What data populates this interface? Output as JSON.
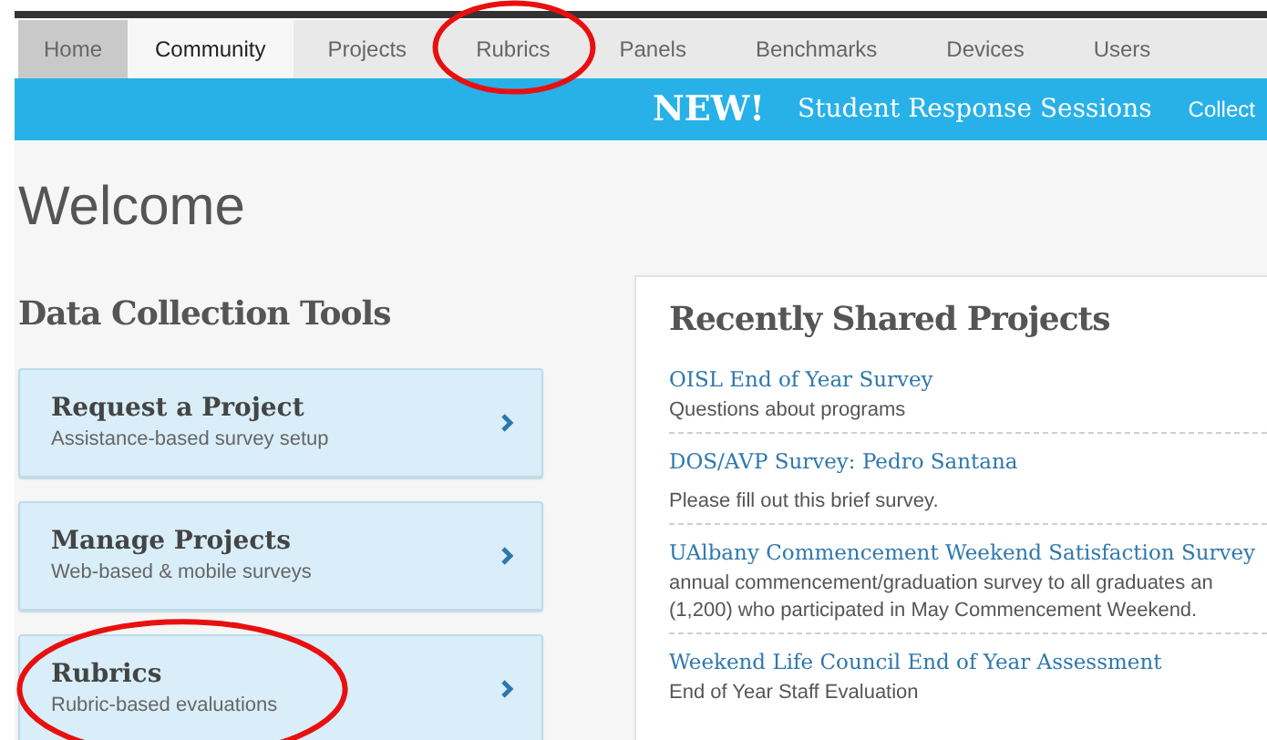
{
  "nav": {
    "items": [
      {
        "label": "Home",
        "selected": false,
        "highlighted": true
      },
      {
        "label": "Community",
        "selected": true,
        "highlighted": false
      },
      {
        "label": "Projects",
        "selected": false,
        "highlighted": false
      },
      {
        "label": "Rubrics",
        "selected": false,
        "highlighted": false,
        "circled": true
      },
      {
        "label": "Panels",
        "selected": false,
        "highlighted": false
      },
      {
        "label": "Benchmarks",
        "selected": false,
        "highlighted": false
      },
      {
        "label": "Devices",
        "selected": false,
        "highlighted": false
      },
      {
        "label": "Users",
        "selected": false,
        "highlighted": false
      }
    ]
  },
  "banner": {
    "badge": "NEW!",
    "title": "Student Response Sessions",
    "link": "Collect"
  },
  "welcome": "Welcome",
  "tools": {
    "heading": "Data Collection Tools",
    "cards": [
      {
        "title": "Request a Project",
        "subtitle": "Assistance-based survey setup",
        "circled": false
      },
      {
        "title": "Manage Projects",
        "subtitle": "Web-based & mobile surveys",
        "circled": false
      },
      {
        "title": "Rubrics",
        "subtitle": "Rubric-based evaluations",
        "circled": true
      }
    ]
  },
  "shared": {
    "heading": "Recently Shared Projects",
    "items": [
      {
        "title": "OISL End of Year Survey",
        "description": [
          "Questions about programs"
        ]
      },
      {
        "title": "DOS/AVP Survey: Pedro Santana",
        "description": [
          "Please fill out this brief survey."
        ]
      },
      {
        "title": "UAlbany Commencement Weekend Satisfaction Survey",
        "description": [
          "annual commencement/graduation survey to all graduates an",
          "(1,200) who participated in May Commencement Weekend."
        ]
      },
      {
        "title": "Weekend Life Council End of Year Assessment",
        "description": [
          "End of Year Staff Evaluation"
        ]
      }
    ]
  }
}
